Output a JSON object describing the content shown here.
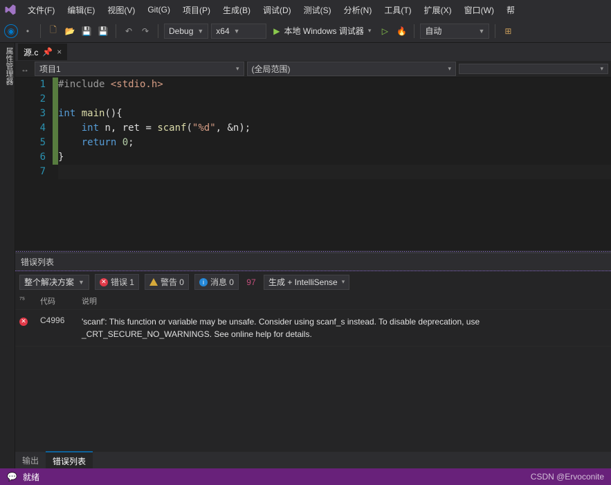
{
  "menu": {
    "items": [
      "文件(F)",
      "编辑(E)",
      "视图(V)",
      "Git(G)",
      "项目(P)",
      "生成(B)",
      "调试(D)",
      "测试(S)",
      "分析(N)",
      "工具(T)",
      "扩展(X)",
      "窗口(W)",
      "帮"
    ]
  },
  "toolbar": {
    "config": "Debug",
    "platform": "x64",
    "run_label": "本地 Windows 调试器",
    "auto_label": "自动"
  },
  "side_panel_label": "属性管理器",
  "tab": {
    "name": "源.c",
    "close": "×"
  },
  "breadcrumb": {
    "project": "项目1",
    "scope": "(全局范围)"
  },
  "code": {
    "lines": [
      {
        "n": 1,
        "html": "<span class='inc'>#include </span><span class='str'>&lt;stdio.h&gt;</span>"
      },
      {
        "n": 2,
        "html": ""
      },
      {
        "n": 3,
        "html": "<span class='kw'>int</span> <span class='fn'>main</span><span class='txt'>(){</span>"
      },
      {
        "n": 4,
        "html": "    <span class='kw'>int</span> <span class='txt'>n, ret = </span><span class='fn'>scanf</span><span class='txt'>(</span><span class='str'>\"%d\"</span><span class='txt'>, &amp;n);</span>"
      },
      {
        "n": 5,
        "html": "    <span class='kw'>return</span> <span class='num'>0</span><span class='txt'>;</span>"
      },
      {
        "n": 6,
        "html": "<span class='txt'>}</span>"
      },
      {
        "n": 7,
        "html": ""
      }
    ]
  },
  "error_panel": {
    "title": "错误列表",
    "scope": "整个解决方案",
    "errors_label": "错误 1",
    "warnings_label": "警告 0",
    "messages_label": "消息 0",
    "build_label": "生成 + IntelliSense",
    "columns": {
      "code": "代码",
      "desc": "说明"
    },
    "rows": [
      {
        "icon": "error",
        "code": "C4996",
        "desc": "'scanf': This function or variable may be unsafe. Consider using scanf_s instead. To disable deprecation, use _CRT_SECURE_NO_WARNINGS. See online help for details."
      }
    ]
  },
  "bottom_tabs": {
    "output": "输出",
    "errors": "错误列表"
  },
  "status": {
    "ready": "就绪",
    "watermark": "CSDN @Ervoconite"
  }
}
